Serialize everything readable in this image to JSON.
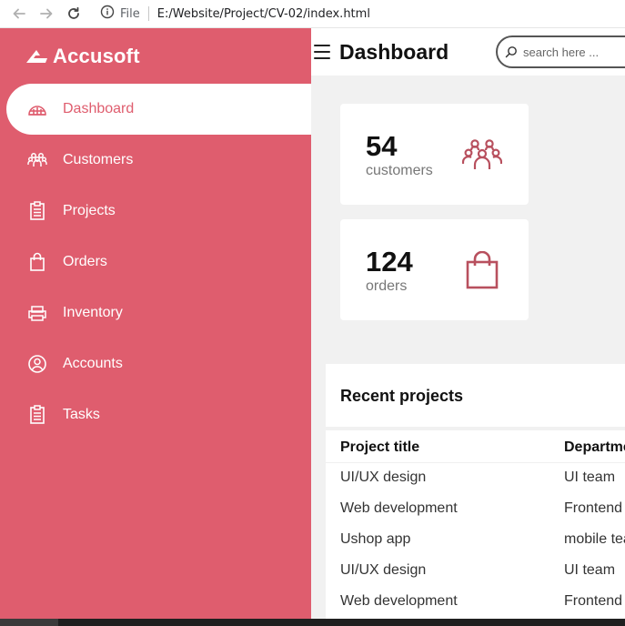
{
  "browser": {
    "file_label": "File",
    "url": "E:/Website/Project/CV-02/index.html"
  },
  "sidebar": {
    "brand": "Accusoft",
    "items": [
      {
        "label": "Dashboard",
        "icon": "dashboard-icon",
        "active": true
      },
      {
        "label": "Customers",
        "icon": "customers-icon"
      },
      {
        "label": "Projects",
        "icon": "clipboard-icon"
      },
      {
        "label": "Orders",
        "icon": "shopping-bag-icon"
      },
      {
        "label": "Inventory",
        "icon": "printer-icon"
      },
      {
        "label": "Accounts",
        "icon": "user-circle-icon"
      },
      {
        "label": "Tasks",
        "icon": "clipboard-icon"
      }
    ]
  },
  "header": {
    "title": "Dashboard",
    "search_placeholder": "search here ..."
  },
  "cards": [
    {
      "number": "54",
      "label": "customers",
      "icon": "customers-icon"
    },
    {
      "number": "124",
      "label": "orders",
      "icon": "shopping-bag-icon"
    }
  ],
  "projects": {
    "title": "Recent projects",
    "columns": [
      "Project title",
      "Departme"
    ],
    "rows": [
      [
        "UI/UX design",
        "UI team"
      ],
      [
        "Web development",
        "Frontend"
      ],
      [
        "Ushop app",
        "mobile tea"
      ],
      [
        "UI/UX design",
        "UI team"
      ],
      [
        "Web development",
        "Frontend"
      ]
    ]
  },
  "colors": {
    "accent": "#df5d6e",
    "icon_accent": "#b8505e",
    "background": "#f1f1f1"
  }
}
